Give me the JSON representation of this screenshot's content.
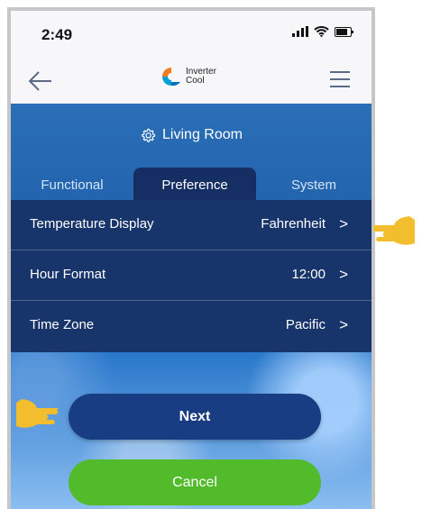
{
  "status_bar": {
    "time": "2:49"
  },
  "header": {
    "logo_line1": "Inverter",
    "logo_line2": "Cool"
  },
  "room": {
    "name": "Living Room"
  },
  "tabs": [
    {
      "label": "Functional",
      "active": false
    },
    {
      "label": "Preference",
      "active": true
    },
    {
      "label": "System",
      "active": false
    }
  ],
  "settings": [
    {
      "label": "Temperature Display",
      "value": "Fahrenheit"
    },
    {
      "label": "Hour Format",
      "value": "12:00"
    },
    {
      "label": "Time Zone",
      "value": "Pacific"
    }
  ],
  "buttons": {
    "next": "Next",
    "cancel": "Cancel"
  },
  "colors": {
    "accent": "#183d82",
    "cancel": "#52bb2c",
    "pointer": "#f3be2e",
    "background": "#2b6fb8"
  },
  "icons": [
    "back-arrow-icon",
    "hamburger-menu-icon",
    "gear-icon",
    "chevron-right-icon",
    "pointing-hand-icon"
  ]
}
